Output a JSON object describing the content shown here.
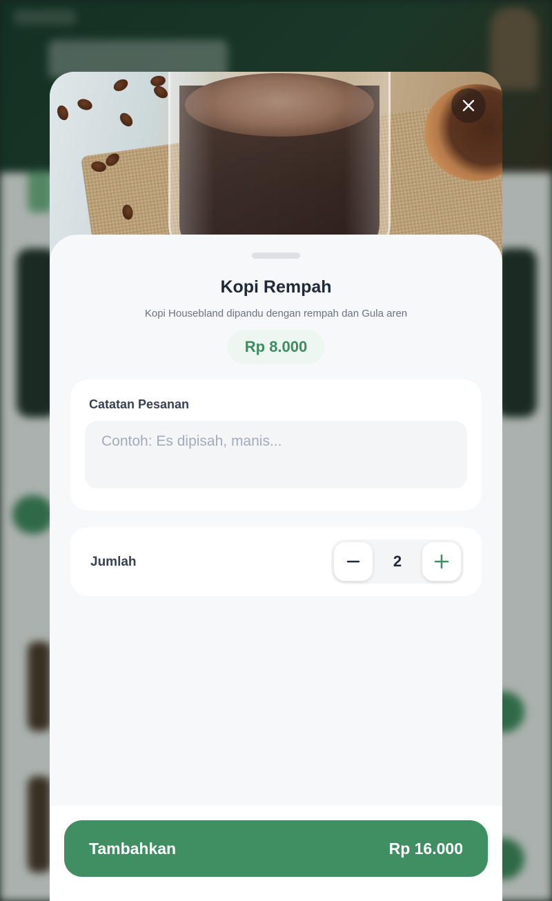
{
  "product": {
    "name": "Kopi Rempah",
    "description": "Kopi Housebland dipandu dengan rempah dan Gula aren",
    "price": "Rp 8.000"
  },
  "notes": {
    "label": "Catatan Pesanan",
    "placeholder": "Contoh: Es dipisah, manis...",
    "value": ""
  },
  "quantity": {
    "label": "Jumlah",
    "value": "2"
  },
  "footer": {
    "add_label": "Tambahkan",
    "total": "Rp 16.000"
  },
  "icons": {
    "close": "close-icon",
    "minus": "minus-icon",
    "plus": "plus-icon"
  },
  "colors": {
    "accent": "#3f8f62",
    "price_text": "#3f8a5f",
    "price_badge_bg": "#eef6f1"
  }
}
